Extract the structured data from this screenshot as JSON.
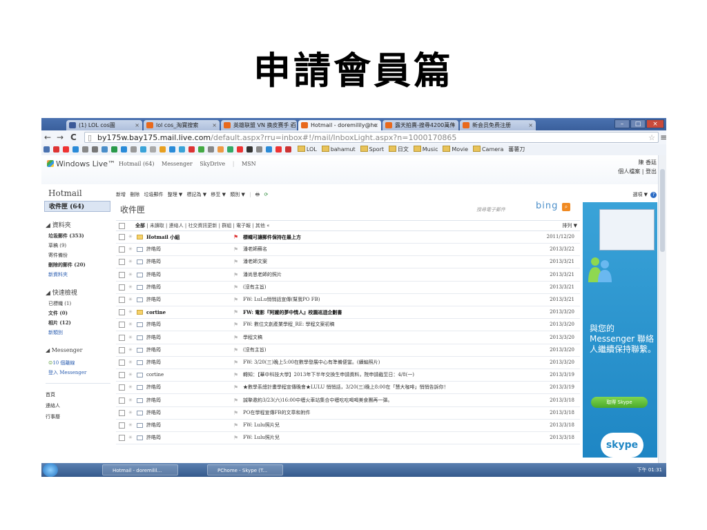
{
  "slide": {
    "title": "申請會員篇"
  },
  "browser": {
    "tabs": [
      {
        "label": "(1) LOL cos圖",
        "color": "#3b5998"
      },
      {
        "label": "lol cos_淘寶搜索",
        "color": "#e8691c"
      },
      {
        "label": "英雄联盟 VN 换皮赛手 百",
        "color": "#e8691c"
      },
      {
        "label": "Hotmail - doremilily@hc",
        "color": "#e8691c",
        "active": true
      },
      {
        "label": "露天拍賣-搜尋4200萬件",
        "color": "#e8691c"
      },
      {
        "label": "新会员免费注册",
        "color": "#e8691c"
      }
    ],
    "url_host": "by175w.bay175.mail.live.com",
    "url_rest": "/default.aspx?rru=inbox#!/mail/InboxLight.aspx?n=1000170865",
    "bookmark_folders": [
      "LOL",
      "bahamut",
      "Sport",
      "日文",
      "Music",
      "Movie",
      "Camera",
      "蕃薯刀"
    ],
    "bookmark_colors": [
      "#4a72b0",
      "#d33",
      "#e33",
      "#2a8bd8",
      "#888",
      "#777",
      "#4a8ec9",
      "#2a9a4a",
      "#2a8bd8",
      "#999",
      "#3aa3d8",
      "#aaa",
      "#e8a020",
      "#2a8bd8",
      "#3aa3d8",
      "#d33",
      "#4a4",
      "#888",
      "#e94",
      "#3a6",
      "#e33",
      "#333",
      "#888",
      "#2a8bd8",
      "#e33",
      "#c33"
    ]
  },
  "hotmail": {
    "brand": "Windows Live™",
    "top_links": [
      "Hotmail (64)",
      "Messenger",
      "SkyDrive",
      "MSN"
    ],
    "user_name": "陳 香廷",
    "user_links": "個人檔案 | 登出",
    "title": "Hotmail",
    "toolbar": [
      "新增",
      "刪除",
      "垃圾郵件",
      "整理 ▼",
      "標記為 ▼",
      "移至 ▼",
      "類別 ▼"
    ],
    "options": "選項 ▼"
  },
  "sidebar": {
    "inbox": "收件匣 (64)",
    "folders_heading": "資料夾",
    "folders": [
      {
        "label": "垃圾郵件 (353)",
        "bold": true
      },
      {
        "label": "草稿 (9)"
      },
      {
        "label": "寄件備份"
      },
      {
        "label": "刪除的郵件 (20)",
        "bold": true
      },
      {
        "label": "新資料夾",
        "link": true
      }
    ],
    "quick_heading": "快速檢視",
    "quick": [
      {
        "label": "已標幟 (1)"
      },
      {
        "label": "文件 (0)",
        "bold": true
      },
      {
        "label": "相片 (12)",
        "bold": true
      },
      {
        "label": "新類別",
        "link": true
      }
    ],
    "messenger_heading": "Messenger",
    "messenger": [
      {
        "label": "10 個離線",
        "link": true
      },
      {
        "label": "登入 Messenger",
        "link": true
      }
    ],
    "bottom": [
      "首頁",
      "連絡人",
      "行事曆"
    ]
  },
  "maillist": {
    "title": "收件匣",
    "search_placeholder": "搜尋電子郵件",
    "bing": "bing",
    "filters": [
      "全部",
      "未讀取",
      "連絡人",
      "社交資訊更新",
      "群組",
      "電子報",
      "其他",
      "«"
    ],
    "sort": "排列 ▼",
    "rows": [
      {
        "sender": "Hotmail 小組",
        "subject": "標幟可讓郵件保持在最上方",
        "date": "2011/12/20",
        "bold": true,
        "flag": "red",
        "hot": true
      },
      {
        "sender": "許皓筠",
        "subject": "潘老師蘇名",
        "date": "2013/3/22"
      },
      {
        "sender": "許皓筠",
        "subject": "潘老師文案",
        "date": "2013/3/21"
      },
      {
        "sender": "許皓筠",
        "subject": "潘尚思老師的照片",
        "date": "2013/3/21"
      },
      {
        "sender": "許皓筠",
        "subject": "(沒有主旨)",
        "date": "2013/3/21"
      },
      {
        "sender": "許皓筠",
        "subject": "FW: LuLu悄悄話宣傳(幫我PO FB)",
        "date": "2013/3/21"
      },
      {
        "sender": "cortine",
        "subject": "FW: 電影『阿嬤的夢中情人』校園巡迴企劃書",
        "date": "2013/3/20",
        "bold": true,
        "hot": true
      },
      {
        "sender": "許皓筠",
        "subject": "FW: 數位文創產業學程_RE: 學程文案初稿",
        "date": "2013/3/20"
      },
      {
        "sender": "許皓筠",
        "subject": "學程文稿",
        "date": "2013/3/20"
      },
      {
        "sender": "許皓筠",
        "subject": "(沒有主旨)",
        "date": "2013/3/20"
      },
      {
        "sender": "許皓筠",
        "subject": "FW: 3/20(三)晚上5:00在數學發展中心有準備便當。(續編照片)",
        "date": "2013/3/20"
      },
      {
        "sender": "cortine",
        "subject": "轉知：【華中科技大學】2013年下半年交換生申請資料，院申請截至日：4/8(一)",
        "date": "2013/3/19"
      },
      {
        "sender": "許皓筠",
        "subject": "★數學系總計畫學程宣傳晚會★LULU 悄悄話，3/20(三)晚上8:00在「慧大咖啡」悄悄告訴你！",
        "date": "2013/3/19"
      },
      {
        "sender": "許皓筠",
        "subject": "誠摯邀約3/23(六)16:00中壢火車站集合中壢吃吃喝喝美食團再一彈。",
        "date": "2013/3/18"
      },
      {
        "sender": "許皓筠",
        "subject": "PO在學程宣傳FB的文章和附件",
        "date": "2013/3/18"
      },
      {
        "sender": "許皓筠",
        "subject": "FW: Lulu照片兒",
        "date": "2013/3/18"
      },
      {
        "sender": "許皓筠",
        "subject": "FW: Lulu照片兒",
        "date": "2013/3/18"
      }
    ]
  },
  "ad": {
    "headline": "與您的 Messenger 聯絡人繼續保持聯繫。",
    "button": "取得 Skype",
    "logo": "skype",
    "bg": "#1e86c4"
  },
  "taskbar": {
    "items": [
      "Hotmail - doremilil...",
      "PChome - Skype (T..."
    ],
    "clock": "下午 01:31"
  }
}
